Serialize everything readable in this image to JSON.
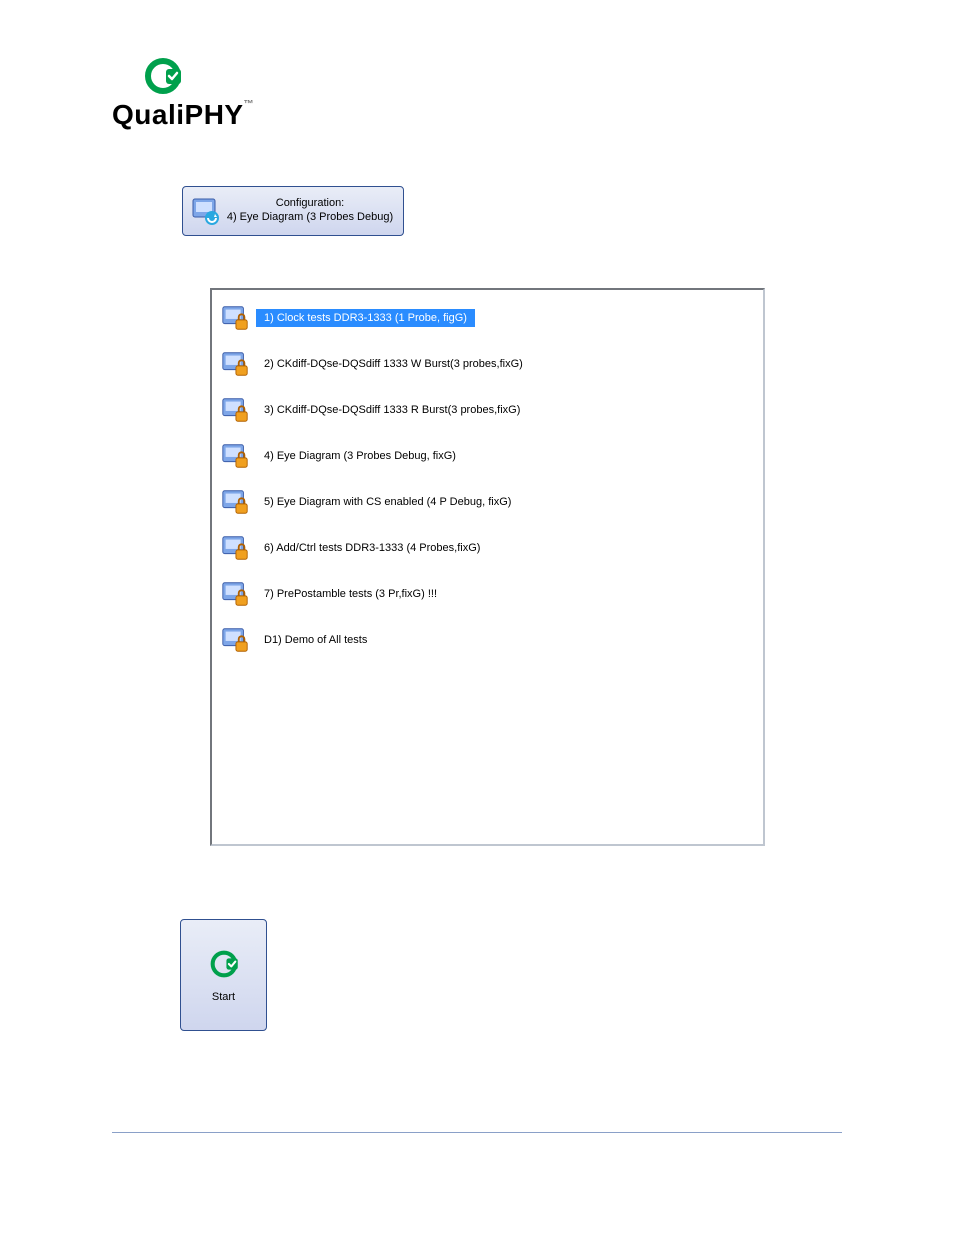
{
  "brand": {
    "left": "Quali",
    "right": "PHY",
    "tm": "™"
  },
  "configButton": {
    "line1": "Configuration:",
    "line2": "4) Eye Diagram (3 Probes Debug)"
  },
  "list": {
    "items": [
      {
        "label": "1) Clock tests DDR3-1333 (1 Probe, figG)",
        "selected": true
      },
      {
        "label": "2) CKdiff-DQse-DQSdiff 1333 W Burst(3 probes,fixG)",
        "selected": false
      },
      {
        "label": "3) CKdiff-DQse-DQSdiff 1333 R Burst(3 probes,fixG)",
        "selected": false
      },
      {
        "label": "4) Eye Diagram (3 Probes Debug, fixG)",
        "selected": false
      },
      {
        "label": "5) Eye Diagram with CS enabled (4 P Debug, fixG)",
        "selected": false
      },
      {
        "label": "6) Add/Ctrl tests DDR3-1333 (4 Probes,fixG)",
        "selected": false
      },
      {
        "label": "7) PrePostamble tests (3 Pr,fixG) !!!",
        "selected": false
      },
      {
        "label": "D1) Demo of All tests",
        "selected": false
      }
    ]
  },
  "startButton": {
    "label": "Start"
  },
  "colors": {
    "accent": "#00a04c",
    "selection": "#2a8cff",
    "buttonBorder": "#305090"
  }
}
